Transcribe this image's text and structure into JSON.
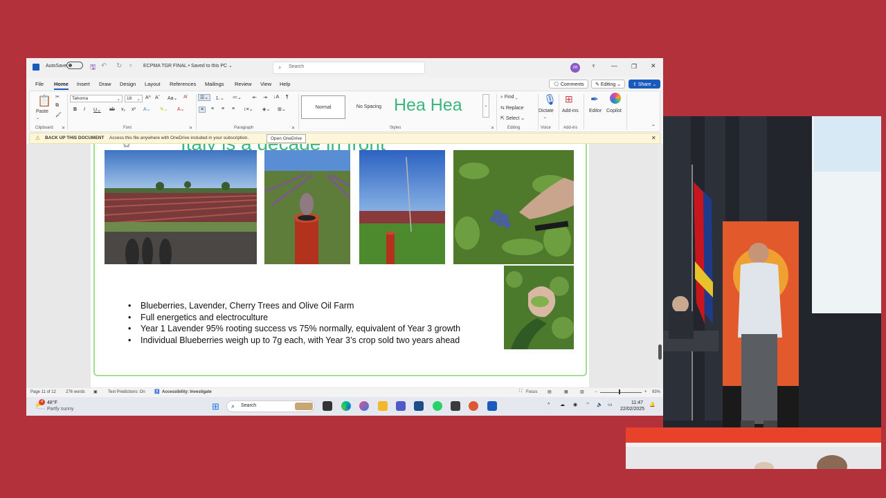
{
  "titlebar": {
    "autosave_label": "AutoSave",
    "document_title": "ECPMA TGR FINAL • Saved to this PC",
    "search_placeholder": "Search",
    "user_initials": "DB"
  },
  "menu": {
    "tabs": [
      "File",
      "Home",
      "Insert",
      "Draw",
      "Design",
      "Layout",
      "References",
      "Mailings",
      "Review",
      "View",
      "Help"
    ],
    "comments": "Comments",
    "editing": "Editing",
    "share": "Share"
  },
  "ribbon": {
    "paste": "Paste",
    "font_name": "Tahoma",
    "font_size": "18",
    "styles": [
      "Normal",
      "No Spacing"
    ],
    "heading_sample": "Hea Hea",
    "find": "Find",
    "replace": "Replace",
    "select": "Select",
    "dictate": "Dictate",
    "addins": "Add-ins",
    "editor": "Editor",
    "copilot": "Copilot",
    "groups": [
      "Clipboard",
      "Font",
      "Paragraph",
      "Styles",
      "Editing",
      "Voice",
      "Add-ins"
    ]
  },
  "notification": {
    "title": "BACK UP THIS DOCUMENT",
    "message": "Access this file anywhere with OneDrive included in your subscription.",
    "button": "Open OneDrive"
  },
  "slide": {
    "title": "Italy is a decade in front",
    "bullets": [
      "Blueberries, Lavender, Cherry Trees and Olive Oil Farm",
      "Full energetics and electroculture",
      "Year 1 Lavender 95% rooting success vs 75% normally, equivalent of Year 3 growth",
      "Individual Blueberries weigh up to 7g each, with Year 3’s crop sold two years ahead"
    ]
  },
  "status": {
    "page": "Page 11 of 12",
    "words": "276 words",
    "predictions": "Text Predictions: On",
    "accessibility": "Accessibility: Investigate",
    "focus": "Focus",
    "zoom": "93%"
  },
  "taskbar": {
    "temperature": "48°F",
    "weather": "Partly sunny",
    "weather_badge": "4",
    "search": "Search",
    "time": "11:47",
    "date": "22/02/2025"
  },
  "colors": {
    "background": "#b3313a",
    "word_blue": "#185abd",
    "slide_title_green": "#3bb77e"
  }
}
